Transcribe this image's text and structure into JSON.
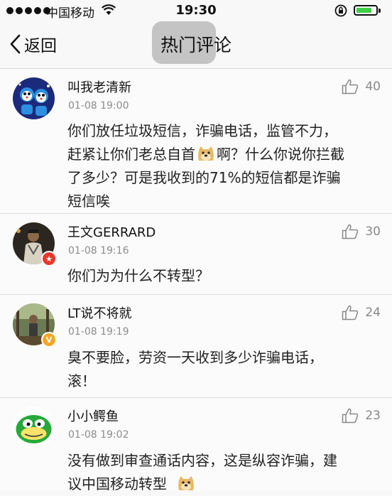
{
  "status": {
    "carrier": "中国移动",
    "time": "19:30",
    "battery_level": 0.8
  },
  "nav": {
    "back_label": "返回",
    "title": "热门评论"
  },
  "comments": [
    {
      "name": "叫我老清新",
      "time": "01-08 19:00",
      "likes": "40",
      "text_1": "你们放任垃圾短信，诈骗电话，监管不力，",
      "text_2a": "赶紧让你们老总自首",
      "text_2b": "啊？什么你说你拦截",
      "text_3": "了多少？可是我收到的71%的短信都是诈骗",
      "text_4": "短信唉"
    },
    {
      "name": "王文GERRARD",
      "time": "01-08 19:16",
      "likes": "30",
      "badge": "★",
      "text_1": "你们为为什么不转型？"
    },
    {
      "name": "LT说不将就",
      "time": "01-08 19:19",
      "likes": "24",
      "badge": "V",
      "text_1": "臭不要脸，劳资一天收到多少诈骗电话，",
      "text_2": "滚！"
    },
    {
      "name": "小小鳄鱼",
      "time": "01-08 19:02",
      "likes": "23",
      "text_1": "没有做到审查通话内容，这是纵容诈骗，建",
      "text_2": "议中国移动转型"
    }
  ],
  "colors": {
    "battery": "#3fcf45",
    "badge_red": "#e8392b",
    "badge_gold": "#f5a623"
  },
  "icons": {
    "like": "thumbs-up-icon",
    "back": "chevron-left-icon"
  }
}
